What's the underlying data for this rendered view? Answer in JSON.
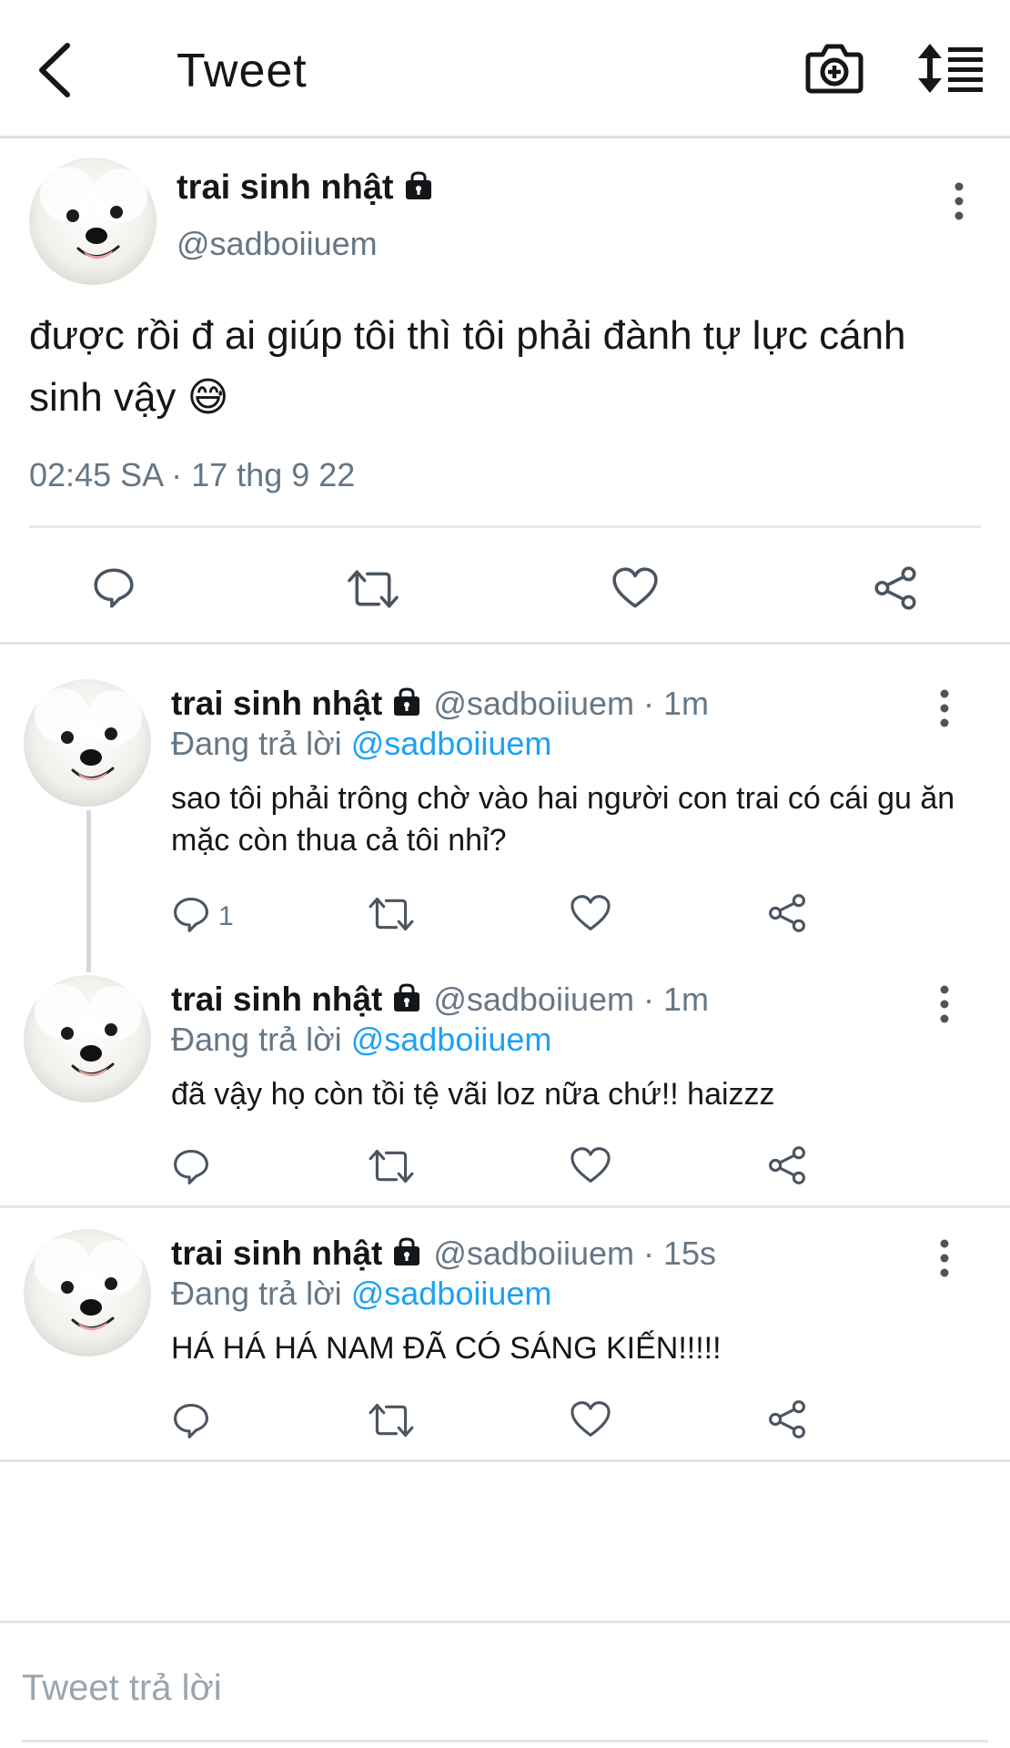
{
  "header": {
    "title": "Tweet",
    "back_icon": "chevron-left-icon",
    "camera_icon": "camera-add-icon",
    "sort_icon": "sort-icon"
  },
  "main_tweet": {
    "name": "trai sinh nhật",
    "handle": "@sadboiiuem",
    "text": "được rồi đ ai giúp tôi thì tôi phải đành tự lực cánh sinh vậy 😅",
    "timestamp": "02:45 SA · 17 thg 9 22"
  },
  "replies": [
    {
      "name": "trai sinh nhật",
      "handle": "@sadboiiuem · 1m",
      "replying_label": "Đang trả lời",
      "replying_to": "@sadboiiuem",
      "text": "sao tôi phải trông chờ vào hai người con trai có cái gu ăn mặc còn thua cả tôi nhỉ?",
      "reply_count": "1"
    },
    {
      "name": "trai sinh nhật",
      "handle": "@sadboiiuem · 1m",
      "replying_label": "Đang trả lời",
      "replying_to": "@sadboiiuem",
      "text": "đã vậy họ còn tồi tệ vãi loz nữa chứ!! haizzz",
      "reply_count": ""
    },
    {
      "name": "trai sinh nhật",
      "handle": "@sadboiiuem · 15s",
      "replying_label": "Đang trả lời",
      "replying_to": "@sadboiiuem",
      "text": "HÁ HÁ HÁ NAM ĐÃ CÓ SÁNG KIẾN!!!!!",
      "reply_count": ""
    }
  ],
  "composer": {
    "placeholder": "Tweet trả lời"
  },
  "colors": {
    "link": "#1da1f2",
    "secondary_text": "#657786",
    "icon": "#4a5560"
  }
}
